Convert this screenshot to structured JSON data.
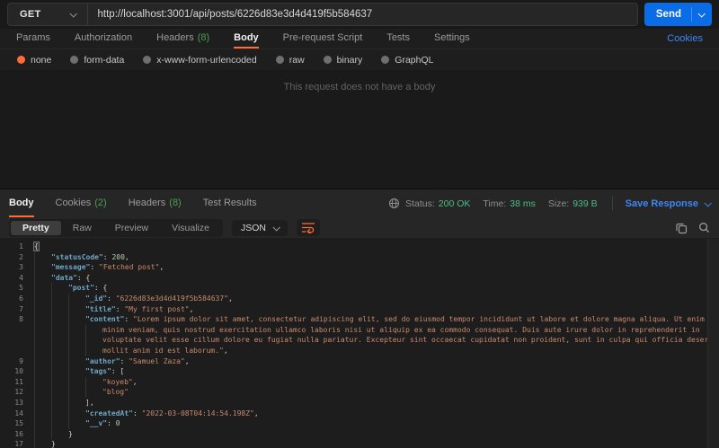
{
  "request": {
    "method": "GET",
    "url": "http://localhost:3001/api/posts/6226d83e3d4d419f5b584637",
    "send_label": "Send",
    "cookies_link": "Cookies",
    "tabs": [
      {
        "label": "Params"
      },
      {
        "label": "Authorization"
      },
      {
        "label": "Headers",
        "count": "(8)"
      },
      {
        "label": "Body",
        "active": true
      },
      {
        "label": "Pre-request Script"
      },
      {
        "label": "Tests"
      },
      {
        "label": "Settings"
      }
    ],
    "body_types": [
      {
        "label": "none",
        "selected": true
      },
      {
        "label": "form-data"
      },
      {
        "label": "x-www-form-urlencoded"
      },
      {
        "label": "raw"
      },
      {
        "label": "binary"
      },
      {
        "label": "GraphQL"
      }
    ],
    "empty_body_message": "This request does not have a body"
  },
  "response": {
    "tabs": [
      {
        "label": "Body",
        "active": true
      },
      {
        "label": "Cookies",
        "count": "(2)"
      },
      {
        "label": "Headers",
        "count": "(8)"
      },
      {
        "label": "Test Results"
      }
    ],
    "meta": {
      "status_label": "Status:",
      "status_value": "200 OK",
      "time_label": "Time:",
      "time_value": "38 ms",
      "size_label": "Size:",
      "size_value": "939 B",
      "save_label": "Save Response"
    },
    "view_tabs": [
      {
        "label": "Pretty",
        "active": true
      },
      {
        "label": "Raw"
      },
      {
        "label": "Preview"
      },
      {
        "label": "Visualize"
      }
    ],
    "format": "JSON",
    "code_lines": [
      {
        "n": "1",
        "i": 0,
        "t": [
          [
            "b",
            "{"
          ]
        ]
      },
      {
        "n": "2",
        "i": 1,
        "t": [
          [
            "k",
            "\"statusCode\""
          ],
          [
            "p",
            ": "
          ],
          [
            "n",
            "200"
          ],
          [
            "p",
            ","
          ]
        ]
      },
      {
        "n": "3",
        "i": 1,
        "t": [
          [
            "k",
            "\"message\""
          ],
          [
            "p",
            ": "
          ],
          [
            "s",
            "\"Fetched post\""
          ],
          [
            "p",
            ","
          ]
        ]
      },
      {
        "n": "4",
        "i": 1,
        "t": [
          [
            "k",
            "\"data\""
          ],
          [
            "p",
            ": {"
          ]
        ]
      },
      {
        "n": "5",
        "i": 2,
        "t": [
          [
            "k",
            "\"post\""
          ],
          [
            "p",
            ": {"
          ]
        ]
      },
      {
        "n": "6",
        "i": 3,
        "t": [
          [
            "k",
            "\"_id\""
          ],
          [
            "p",
            ": "
          ],
          [
            "s",
            "\"6226d83e3d4d419f5b584637\""
          ],
          [
            "p",
            ","
          ]
        ]
      },
      {
        "n": "7",
        "i": 3,
        "t": [
          [
            "k",
            "\"title\""
          ],
          [
            "p",
            ": "
          ],
          [
            "s",
            "\"My first post\""
          ],
          [
            "p",
            ","
          ]
        ]
      },
      {
        "n": "8",
        "i": 3,
        "t": [
          [
            "k",
            "\"content\""
          ],
          [
            "p",
            ": "
          ],
          [
            "s",
            "\"Lorem ipsum dolor sit amet, consectetur adipiscing elit, sed do eiusmod tempor incididunt ut labore et dolore magna aliqua. Ut enim ad"
          ]
        ]
      },
      {
        "n": "",
        "i": 4,
        "t": [
          [
            "s",
            "minim veniam, quis nostrud exercitation ullamco laboris nisi ut aliquip ex ea commodo consequat. Duis aute irure dolor in reprehenderit in"
          ]
        ]
      },
      {
        "n": "",
        "i": 4,
        "t": [
          [
            "s",
            "voluptate velit esse cillum dolore eu fugiat nulla pariatur. Excepteur sint occaecat cupidatat non proident, sunt in culpa qui officia deserunt"
          ]
        ]
      },
      {
        "n": "",
        "i": 4,
        "t": [
          [
            "s",
            "mollit anim id est laborum.\""
          ],
          [
            "p",
            ","
          ]
        ]
      },
      {
        "n": "9",
        "i": 3,
        "t": [
          [
            "k",
            "\"author\""
          ],
          [
            "p",
            ": "
          ],
          [
            "s",
            "\"Samuel Zaza\""
          ],
          [
            "p",
            ","
          ]
        ]
      },
      {
        "n": "10",
        "i": 3,
        "t": [
          [
            "k",
            "\"tags\""
          ],
          [
            "p",
            ": ["
          ]
        ]
      },
      {
        "n": "11",
        "i": 4,
        "t": [
          [
            "s",
            "\"koyeb\""
          ],
          [
            "p",
            ","
          ]
        ]
      },
      {
        "n": "12",
        "i": 4,
        "t": [
          [
            "s",
            "\"blog\""
          ]
        ]
      },
      {
        "n": "13",
        "i": 3,
        "t": [
          [
            "p",
            "],"
          ]
        ]
      },
      {
        "n": "14",
        "i": 3,
        "t": [
          [
            "k",
            "\"createdAt\""
          ],
          [
            "p",
            ": "
          ],
          [
            "s",
            "\"2022-03-08T04:14:54.198Z\""
          ],
          [
            "p",
            ","
          ]
        ]
      },
      {
        "n": "15",
        "i": 3,
        "t": [
          [
            "k",
            "\"__v\""
          ],
          [
            "p",
            ": "
          ],
          [
            "n",
            "0"
          ]
        ]
      },
      {
        "n": "16",
        "i": 2,
        "t": [
          [
            "p",
            "}"
          ]
        ]
      },
      {
        "n": "17",
        "i": 1,
        "t": [
          [
            "p",
            "}"
          ]
        ]
      }
    ]
  },
  "colors": {
    "accent_orange": "#ff6c37",
    "send_button_blue": "#0b6ce8",
    "link_blue": "#3f87f5",
    "count_green": "#4f9e54",
    "status_green": "#4cbd82",
    "json_key_blue": "#6fa7c7",
    "json_string_orange": "#c98a6d",
    "json_number_green": "#b5cea8"
  }
}
